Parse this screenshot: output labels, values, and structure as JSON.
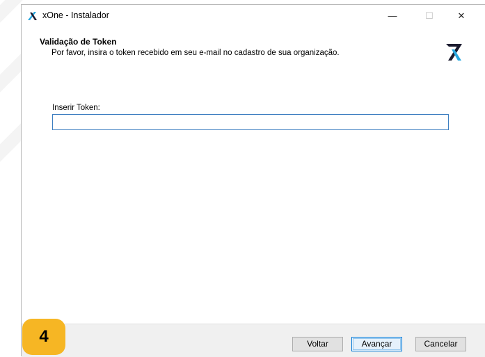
{
  "window": {
    "title": "xOne - Instalador",
    "minimize_glyph": "—",
    "maximize_glyph": "☐",
    "close_glyph": "✕"
  },
  "header": {
    "title": "Validação de Token",
    "subtitle": "Por favor, insira o token recebido em seu e-mail no cadastro de sua organização.",
    "logo_icon": "xone-logo-icon"
  },
  "form": {
    "token_label": "Inserir Token:",
    "token_value": ""
  },
  "footer": {
    "back_label": "Voltar",
    "next_label": "Avançar",
    "cancel_label": "Cancelar"
  },
  "step_badge": "4",
  "colors": {
    "accent": "#0078d7",
    "input_border": "#3e7fc1",
    "badge": "#f6b624",
    "logo_dark": "#1a1a2e",
    "logo_blue": "#29a8e0"
  }
}
